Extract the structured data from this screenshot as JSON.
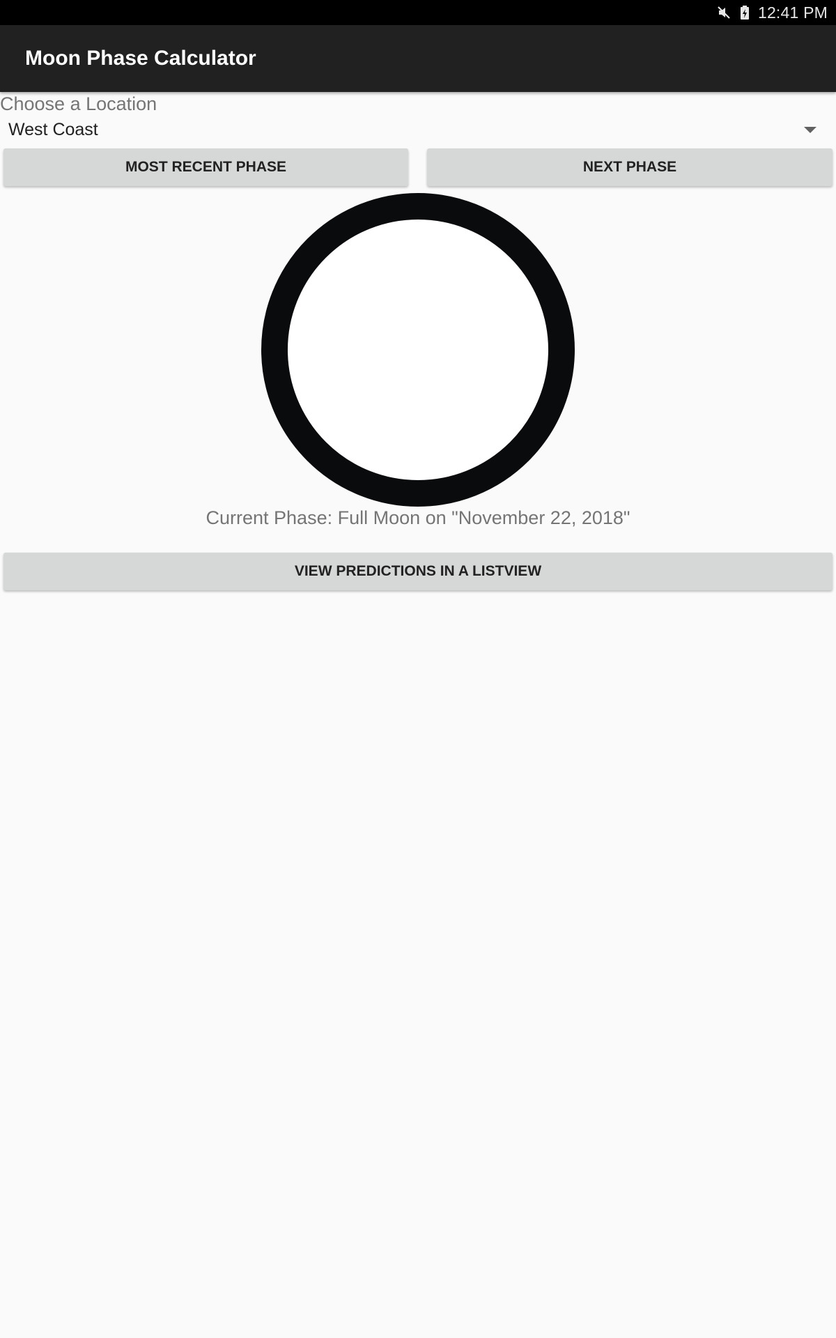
{
  "status_bar": {
    "time": "12:41 PM",
    "icons": [
      "mute-icon",
      "battery-charging-icon"
    ]
  },
  "app_bar": {
    "title": "Moon Phase Calculator"
  },
  "location": {
    "label": "Choose a Location",
    "selected": "West Coast"
  },
  "buttons": {
    "most_recent": "MOST RECENT PHASE",
    "next": "NEXT PHASE",
    "listview": "VIEW PREDICTIONS IN A LISTVIEW"
  },
  "moon": {
    "phase_icon": "full-moon-icon",
    "ring_color": "#0a0b0d",
    "fill_color": "#ffffff"
  },
  "current_phase": {
    "text": "Current Phase: Full Moon on \"November 22, 2018\""
  },
  "colors": {
    "app_bar": "#212121",
    "status_bar": "#000000",
    "background": "#fafafa",
    "button": "#d6d7d7"
  }
}
